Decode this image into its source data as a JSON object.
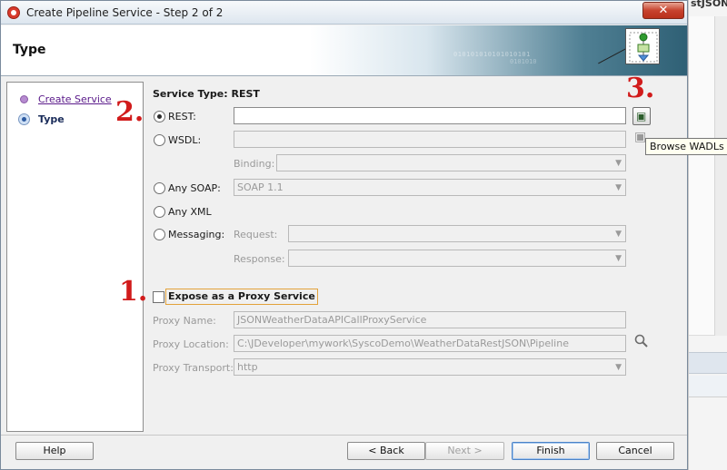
{
  "background_app": {
    "title_fragment": "stJSON"
  },
  "window": {
    "title": "Create Pipeline Service - Step 2 of 2",
    "close_glyph": "✕"
  },
  "header": {
    "title": "Type",
    "binary_text": "010101010101010101",
    "binary_text2": "0101010"
  },
  "nav": {
    "items": [
      {
        "label": "Create Service",
        "state": "visited"
      },
      {
        "label": "Type",
        "state": "current"
      }
    ]
  },
  "annotations": {
    "one": "1.",
    "two": "2.",
    "three": "3."
  },
  "form": {
    "section_title": "Service Type: REST",
    "rest": {
      "label": "REST:",
      "selected": true,
      "value": ""
    },
    "wsdl": {
      "label": "WSDL:",
      "selected": false,
      "value": ""
    },
    "binding": {
      "label": "Binding:",
      "value": ""
    },
    "any_soap": {
      "label": "Any SOAP:",
      "selected": false,
      "value": "SOAP 1.1"
    },
    "any_xml": {
      "label": "Any XML",
      "selected": false
    },
    "messaging": {
      "label": "Messaging:",
      "selected": false
    },
    "request": {
      "label": "Request:",
      "value": ""
    },
    "response": {
      "label": "Response:",
      "value": ""
    },
    "expose_proxy": {
      "label": "Expose as a Proxy Service",
      "checked": false
    },
    "proxy_name": {
      "label": "Proxy Name:",
      "value": "JSONWeatherDataAPICallProxyService"
    },
    "proxy_location": {
      "label": "Proxy Location:",
      "value": "C:\\JDeveloper\\mywork\\SyscoDemo\\WeatherDataRestJSON\\Pipeline"
    },
    "proxy_transport": {
      "label": "Proxy Transport:",
      "value": "http"
    },
    "browse_tooltip": "Browse WADLs"
  },
  "footer": {
    "help": "Help",
    "back": "< Back",
    "next": "Next >",
    "finish": "Finish",
    "cancel": "Cancel"
  },
  "colors": {
    "accent": "#2d5aa0",
    "annotation": "#d11b1b",
    "link_visited": "#5a1a8a",
    "focus_outline": "#e3a23b"
  },
  "icons": [
    "app-icon",
    "close-icon",
    "wizard-icon",
    "browse-wadl-icon",
    "browse-wsdl-icon",
    "search-icon",
    "chevron-down-icon"
  ]
}
